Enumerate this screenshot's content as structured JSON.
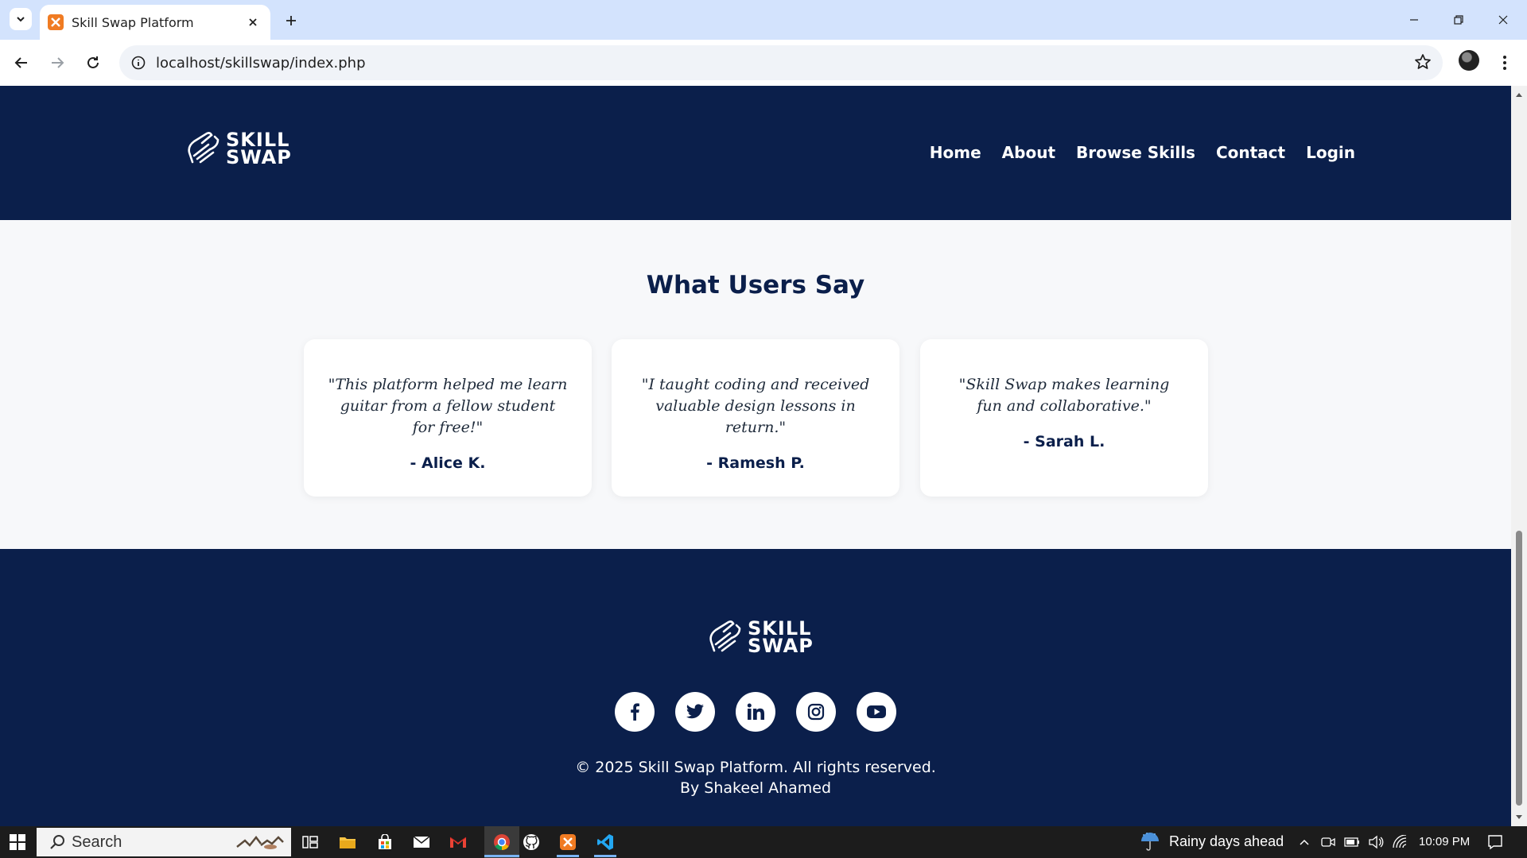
{
  "browser": {
    "tab_title": "Skill Swap Platform",
    "url": "localhost/skillswap/index.php"
  },
  "site": {
    "logo_line1": "SKILL",
    "logo_line2": "SWAP",
    "nav": [
      "Home",
      "About",
      "Browse Skills",
      "Contact",
      "Login"
    ]
  },
  "testimonials": {
    "title": "What Users Say",
    "items": [
      {
        "quote": "\"This platform helped me learn guitar from a fellow student for free!\"",
        "author": "- Alice K."
      },
      {
        "quote": "\"I taught coding and received valuable design lessons in return.\"",
        "author": "- Ramesh P."
      },
      {
        "quote": "\"Skill Swap makes learning fun and collaborative.\"",
        "author": "- Sarah L."
      }
    ]
  },
  "footer": {
    "copyright_line1": "© 2025 Skill Swap Platform. All rights reserved.",
    "copyright_line2": "By Shakeel Ahamed",
    "social": [
      "facebook-icon",
      "twitter-icon",
      "linkedin-icon",
      "instagram-icon",
      "youtube-icon"
    ]
  },
  "taskbar": {
    "search_label": "Search",
    "weather": "Rainy days ahead",
    "time": "10:09 PM"
  },
  "colors": {
    "navy": "#0b1f4b",
    "tab_strip": "#d3e3fd"
  }
}
